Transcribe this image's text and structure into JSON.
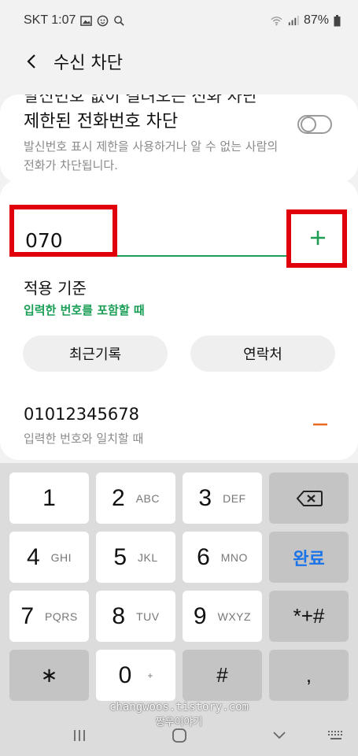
{
  "status_bar": {
    "carrier_time": "SKT 1:07",
    "battery": "87%"
  },
  "header": {
    "title": "수신 차단"
  },
  "restricted_card": {
    "cut_text": "발신번호 없이 걸려오는 전화 차단",
    "title": "제한된 전화번호 차단",
    "description": "발신번호 표시 제한을 사용하거나 알 수 없는 사람의 전화가 차단됩니다.",
    "toggle_on": false
  },
  "block_form": {
    "number_value": "070",
    "criteria_label": "적용 기준",
    "criteria_value": "입력한 번호를 포함할 때",
    "recent_button": "최근기록",
    "contacts_button": "연락처"
  },
  "blocked_list": [
    {
      "number": "01012345678",
      "rule": "입력한 번호와 일치할 때"
    }
  ],
  "keypad": {
    "rows": [
      [
        {
          "digit": "1",
          "letters": ""
        },
        {
          "digit": "2",
          "letters": "ABC"
        },
        {
          "digit": "3",
          "letters": "DEF"
        }
      ],
      [
        {
          "digit": "4",
          "letters": "GHI"
        },
        {
          "digit": "5",
          "letters": "JKL"
        },
        {
          "digit": "6",
          "letters": "MNO"
        }
      ],
      [
        {
          "digit": "7",
          "letters": "PQRS"
        },
        {
          "digit": "8",
          "letters": "TUV"
        },
        {
          "digit": "9",
          "letters": "WXYZ"
        }
      ],
      [
        {
          "digit": "*",
          "letters": ""
        },
        {
          "digit": "0",
          "letters": "+"
        },
        {
          "digit": "#",
          "letters": ""
        }
      ]
    ],
    "done_label": "완료",
    "symbols_label": "*+#",
    "comma_label": ",",
    "asterisk_label": "∗"
  },
  "watermark": {
    "line1": "changwoos.tistory.com",
    "line2": "짱우이야기"
  },
  "colors": {
    "accent_green": "#1f9d55",
    "highlight_red": "#e0000a",
    "remove_orange": "#e86b1f",
    "done_blue": "#1a73e8"
  },
  "icons": {
    "back": "chevron-left-icon",
    "add": "plus-icon",
    "remove": "minus-icon",
    "backspace": "backspace-icon"
  }
}
